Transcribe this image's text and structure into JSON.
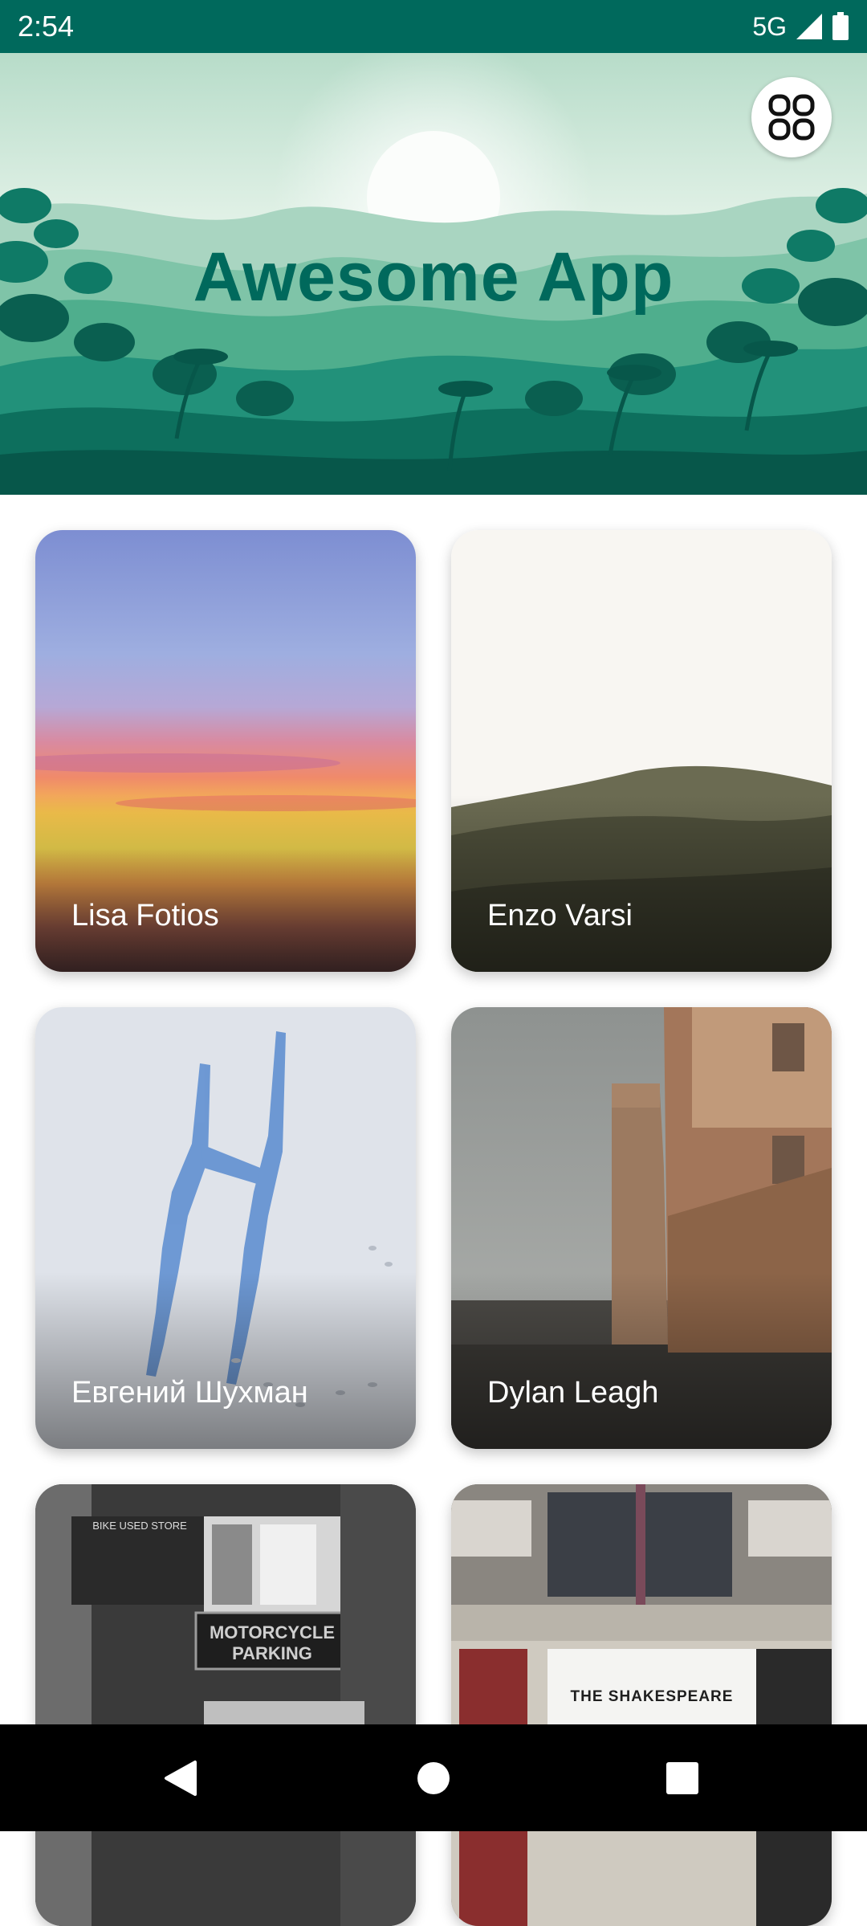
{
  "status_bar": {
    "time": "2:54",
    "network": "5G"
  },
  "header": {
    "title": "Awesome App",
    "menu_icon": "grid-view-icon"
  },
  "cards": [
    {
      "name": "Lisa Fotios"
    },
    {
      "name": "Enzo Varsi"
    },
    {
      "name": "Евгений Шухман"
    },
    {
      "name": "Dylan Leagh"
    },
    {
      "name": ""
    },
    {
      "name": ""
    }
  ],
  "photo_text": {
    "store_sign": "BIKE USED STORE",
    "parking_sign_line1": "MOTORCYCLE",
    "parking_sign_line2": "PARKING",
    "pub_sign": "THE SHAKESPEARE"
  },
  "nav": {
    "back_icon": "back-triangle-icon",
    "home_icon": "home-circle-icon",
    "recents_icon": "recents-square-icon"
  },
  "colors": {
    "primary": "#00695c",
    "title": "#00695c"
  }
}
